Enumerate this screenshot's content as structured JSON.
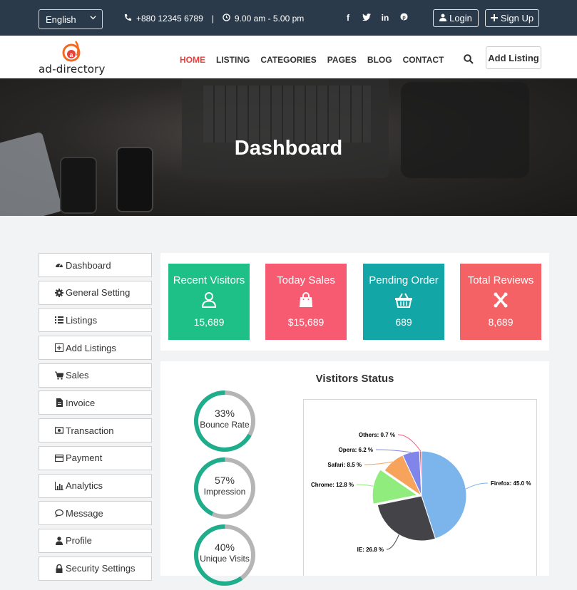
{
  "topbar": {
    "language": "English",
    "phone": "+880 12345 6789",
    "separator": "|",
    "hours": "9.00 am - 5.00 pm",
    "socials": [
      "facebook-icon",
      "twitter-icon",
      "linkedin-icon",
      "pinterest-icon"
    ],
    "login_label": "Login",
    "signup_label": "Sign Up"
  },
  "navbar": {
    "logo_text": "ad-directory",
    "menu": [
      "HOME",
      "LISTING",
      "CATEGORIES",
      "PAGES",
      "BLOG",
      "CONTACT"
    ],
    "active": "HOME",
    "add_listing_label": "Add Listing"
  },
  "hero": {
    "title": "Dashboard"
  },
  "sidebar": {
    "items": [
      {
        "label": "Dashboard",
        "icon": "dashboard-icon"
      },
      {
        "label": "General Setting",
        "icon": "gear-icon"
      },
      {
        "label": "Listings",
        "icon": "list-icon"
      },
      {
        "label": "Add Listings",
        "icon": "plus-square-icon"
      },
      {
        "label": "Sales",
        "icon": "cart-icon"
      },
      {
        "label": "Invoice",
        "icon": "file-icon"
      },
      {
        "label": "Transaction",
        "icon": "money-icon"
      },
      {
        "label": "Payment",
        "icon": "credit-card-icon"
      },
      {
        "label": "Analytics",
        "icon": "bar-chart-icon"
      },
      {
        "label": "Message",
        "icon": "comment-icon"
      },
      {
        "label": "Profile",
        "icon": "user-icon"
      },
      {
        "label": "Security Settings",
        "icon": "lock-icon"
      }
    ]
  },
  "stats": [
    {
      "title": "Recent Visitors",
      "value": "15,689",
      "color": "#1fc087",
      "icon": "user-icon"
    },
    {
      "title": "Today Sales",
      "value": "$15,689",
      "color": "#f75b72",
      "icon": "shopping-bag-icon"
    },
    {
      "title": "Pending Order",
      "value": "689",
      "color": "#12a6a6",
      "icon": "basket-icon"
    },
    {
      "title": "Total Reviews",
      "value": "8,689",
      "color": "#f56266",
      "icon": "joomla-icon"
    }
  ],
  "status": {
    "title": "Vistitors Status",
    "rings": [
      {
        "percent": "33%",
        "value": 33,
        "label": "Bounce Rate"
      },
      {
        "percent": "57%",
        "value": 57,
        "label": "Impression"
      },
      {
        "percent": "40%",
        "value": 40,
        "label": "Unique Visits"
      }
    ],
    "ring_color": "#1fae8c",
    "ring_track": "#b5b5b5"
  },
  "chart_data": {
    "type": "pie",
    "title": "",
    "slices": [
      {
        "name": "Firefox",
        "label": "Firefox: 45.0 %",
        "value": 45.0,
        "color": "#7cb5ec"
      },
      {
        "name": "IE",
        "label": "IE: 26.8 %",
        "value": 26.8,
        "color": "#434348"
      },
      {
        "name": "Chrome",
        "label": "Chrome: 12.8 %",
        "value": 12.8,
        "color": "#90ed7d"
      },
      {
        "name": "Safari",
        "label": "Safari: 8.5 %",
        "value": 8.5,
        "color": "#f7a35c"
      },
      {
        "name": "Opera",
        "label": "Opera: 6.2 %",
        "value": 6.2,
        "color": "#8085e9"
      },
      {
        "name": "Others",
        "label": "Others: 0.7 %",
        "value": 0.7,
        "color": "#f15c80"
      }
    ]
  }
}
